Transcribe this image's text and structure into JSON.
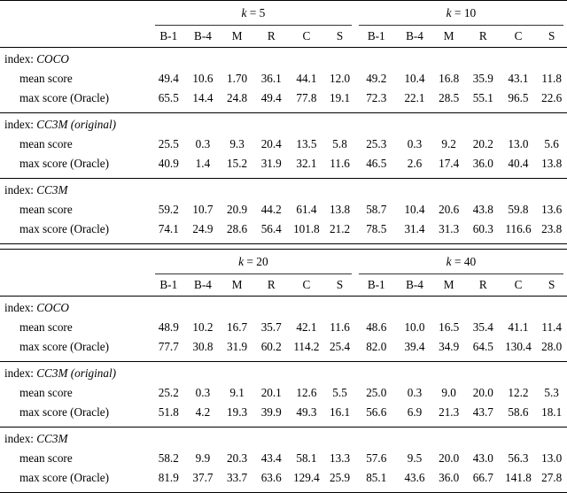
{
  "document": {
    "type": "results-table",
    "caption_free": true
  },
  "tables": [
    {
      "id": "table-top",
      "groups": [
        {
          "label_prefix": "k",
          "label_eq": " = ",
          "label_value": "5",
          "label": "k = 5"
        },
        {
          "label_prefix": "k",
          "label_eq": " = ",
          "label_value": "10",
          "label": "k = 10"
        }
      ],
      "metric_headers": [
        "B-1",
        "B-4",
        "M",
        "R",
        "C",
        "S",
        "B-1",
        "B-4",
        "M",
        "R",
        "C",
        "S"
      ],
      "sections": [
        {
          "header_prefix": "index: ",
          "header_name": "COCO",
          "rows": [
            {
              "label": "mean score",
              "values": [
                "49.4",
                "10.6",
                "1.70",
                "36.1",
                "44.1",
                "12.0",
                "49.2",
                "10.4",
                "16.8",
                "35.9",
                "43.1",
                "11.8"
              ]
            },
            {
              "label": "max score (Oracle)",
              "values": [
                "65.5",
                "14.4",
                "24.8",
                "49.4",
                "77.8",
                "19.1",
                "72.3",
                "22.1",
                "28.5",
                "55.1",
                "96.5",
                "22.6"
              ]
            }
          ]
        },
        {
          "header_prefix": "index: ",
          "header_name": "CC3M (original)",
          "rows": [
            {
              "label": "mean score",
              "values": [
                "25.5",
                "0.3",
                "9.3",
                "20.4",
                "13.5",
                "5.8",
                "25.3",
                "0.3",
                "9.2",
                "20.2",
                "13.0",
                "5.6"
              ]
            },
            {
              "label": "max score (Oracle)",
              "values": [
                "40.9",
                "1.4",
                "15.2",
                "31.9",
                "32.1",
                "11.6",
                "46.5",
                "2.6",
                "17.4",
                "36.0",
                "40.4",
                "13.8"
              ]
            }
          ]
        },
        {
          "header_prefix": "index: ",
          "header_name": "CC3M",
          "rows": [
            {
              "label": "mean score",
              "values": [
                "59.2",
                "10.7",
                "20.9",
                "44.2",
                "61.4",
                "13.8",
                "58.7",
                "10.4",
                "20.6",
                "43.8",
                "59.8",
                "13.6"
              ]
            },
            {
              "label": "max score (Oracle)",
              "values": [
                "74.1",
                "24.9",
                "28.6",
                "56.4",
                "101.8",
                "21.2",
                "78.5",
                "31.4",
                "31.3",
                "60.3",
                "116.6",
                "23.8"
              ]
            }
          ]
        }
      ]
    },
    {
      "id": "table-bottom",
      "groups": [
        {
          "label_prefix": "k",
          "label_eq": " = ",
          "label_value": "20",
          "label": "k = 20"
        },
        {
          "label_prefix": "k",
          "label_eq": " = ",
          "label_value": "40",
          "label": "k = 40"
        }
      ],
      "metric_headers": [
        "B-1",
        "B-4",
        "M",
        "R",
        "C",
        "S",
        "B-1",
        "B-4",
        "M",
        "R",
        "C",
        "S"
      ],
      "sections": [
        {
          "header_prefix": "index: ",
          "header_name": "COCO",
          "rows": [
            {
              "label": "mean score",
              "values": [
                "48.9",
                "10.2",
                "16.7",
                "35.7",
                "42.1",
                "11.6",
                "48.6",
                "10.0",
                "16.5",
                "35.4",
                "41.1",
                "11.4"
              ]
            },
            {
              "label": "max score (Oracle)",
              "values": [
                "77.7",
                "30.8",
                "31.9",
                "60.2",
                "114.2",
                "25.4",
                "82.0",
                "39.4",
                "34.9",
                "64.5",
                "130.4",
                "28.0"
              ]
            }
          ]
        },
        {
          "header_prefix": "index: ",
          "header_name": "CC3M (original)",
          "rows": [
            {
              "label": "mean score",
              "values": [
                "25.2",
                "0.3",
                "9.1",
                "20.1",
                "12.6",
                "5.5",
                "25.0",
                "0.3",
                "9.0",
                "20.0",
                "12.2",
                "5.3"
              ]
            },
            {
              "label": "max score (Oracle)",
              "values": [
                "51.8",
                "4.2",
                "19.3",
                "39.9",
                "49.3",
                "16.1",
                "56.6",
                "6.9",
                "21.3",
                "43.7",
                "58.6",
                "18.1"
              ]
            }
          ]
        },
        {
          "header_prefix": "index: ",
          "header_name": "CC3M",
          "rows": [
            {
              "label": "mean score",
              "values": [
                "58.2",
                "9.9",
                "20.3",
                "43.4",
                "58.1",
                "13.3",
                "57.6",
                "9.5",
                "20.0",
                "43.0",
                "56.3",
                "13.0"
              ]
            },
            {
              "label": "max score (Oracle)",
              "values": [
                "81.9",
                "37.7",
                "33.7",
                "63.6",
                "129.4",
                "25.9",
                "85.1",
                "43.6",
                "36.0",
                "66.7",
                "141.8",
                "27.8"
              ]
            }
          ]
        }
      ]
    }
  ]
}
